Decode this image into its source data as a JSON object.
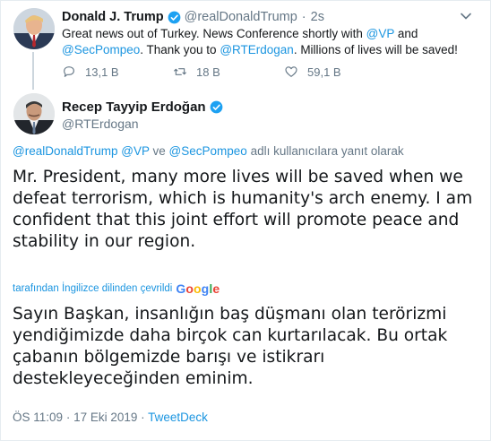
{
  "parent_tweet": {
    "name": "Donald J. Trump",
    "handle": "@realDonaldTrump",
    "separator": "·",
    "time": "2s",
    "text_part1": "Great news out of Turkey. News Conference shortly with ",
    "mention_vp": "@VP",
    "text_part2": " and ",
    "mention_pompeo": "@SecPompeo",
    "text_part3": ". Thank you to ",
    "mention_erdogan": "@RTErdogan",
    "text_part4": ". Millions of lives will be saved!",
    "replies": "13,1 B",
    "retweets": "18 B",
    "likes": "59,1 B"
  },
  "main_tweet": {
    "name": "Recep Tayyip Erdoğan",
    "handle": "@RTErdogan",
    "replying": {
      "m1": "@realDonaldTrump",
      "m2": "@VP",
      "conj": "ve",
      "m3": "@SecPompeo",
      "suffix": "adlı kullanıcılara yanıt olarak"
    },
    "text": "Mr. President, many more lives will be saved when we defeat terrorism, which is humanity's arch enemy. I am confident that this joint effort will promote peace and stability in our region.",
    "translated_by": "tarafından İngilizce dilinden çevrildi",
    "translated_brand": "Google",
    "translation": "Sayın Başkan, insanlığın baş düşmanı olan terörizmi yendiğimizde daha birçok can kurtarılacak. Bu ortak çabanın bölgemizde barışı ve istikrarı destekleyeceğinden eminim.",
    "time": "ÖS 11:09",
    "date": "17 Eki 2019",
    "source": "TweetDeck"
  },
  "icons": {
    "verified": "verified-badge-icon",
    "reply": "reply-icon",
    "retweet": "retweet-icon",
    "like": "heart-icon",
    "more": "chevron-down-icon"
  },
  "colors": {
    "accent": "#1b95e0",
    "muted": "#657786",
    "text": "#14171a",
    "verified": "#1da1f2"
  }
}
